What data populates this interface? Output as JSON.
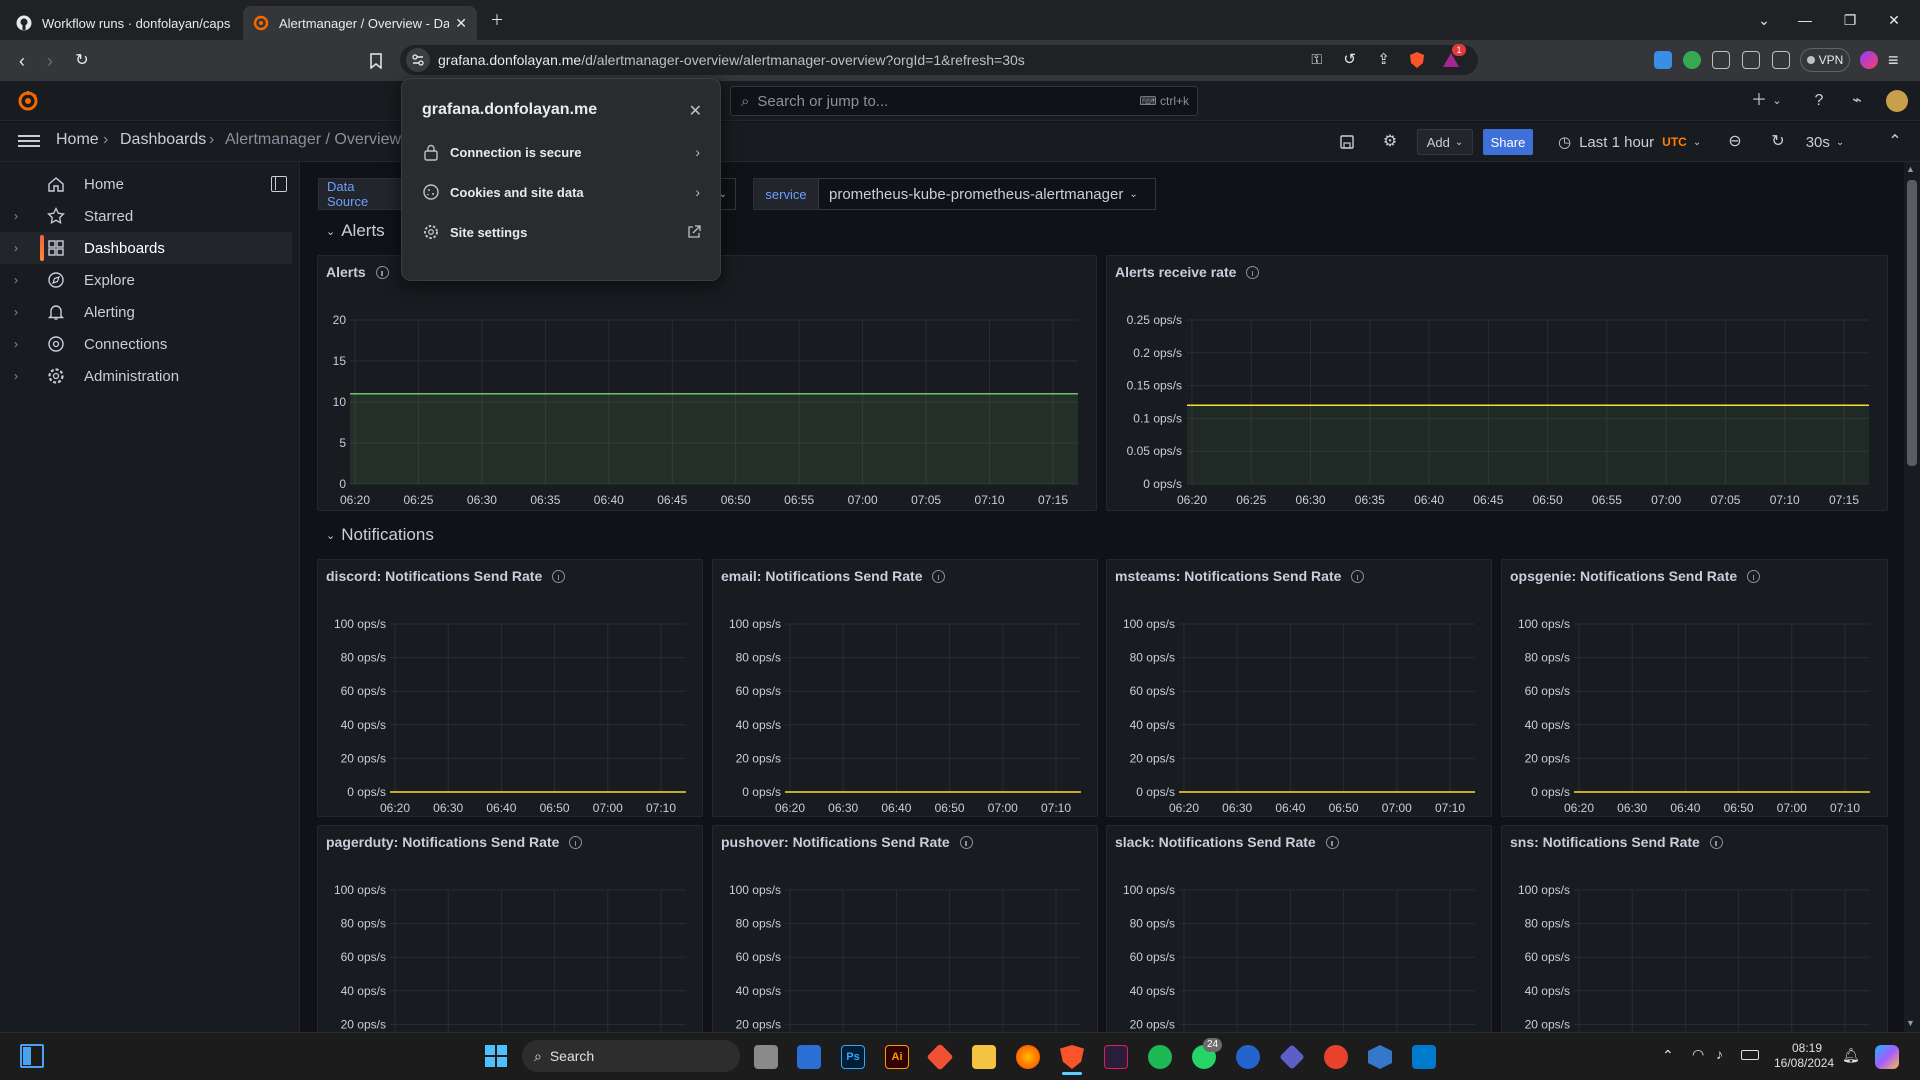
{
  "browser": {
    "tabs": [
      {
        "title": "Workflow runs · donfolayan/capstone",
        "active": false
      },
      {
        "title": "Alertmanager / Overview - Dashboards",
        "active": true
      }
    ],
    "url_host": "grafana.donfolayan.me",
    "url_path": "/d/alertmanager-overview/alertmanager-overview?orgId=1&refresh=30s",
    "vpn_label": "VPN",
    "brave_badge": "1"
  },
  "site_popup": {
    "host": "grafana.donfolayan.me",
    "items": [
      {
        "label": "Connection is secure",
        "icon": "lock-icon"
      },
      {
        "label": "Cookies and site data",
        "icon": "cookie-icon"
      },
      {
        "label": "Site settings",
        "icon": "gear-icon"
      }
    ]
  },
  "grafana": {
    "search_placeholder": "Search or jump to...",
    "search_shortcut": "ctrl+k",
    "breadcrumb": [
      "Home",
      "Dashboards",
      "Alertmanager / Overview"
    ],
    "toolbar": {
      "add": "Add",
      "share": "Share",
      "time_range": "Last 1 hour",
      "timezone": "UTC",
      "refresh": "30s"
    },
    "nav": [
      {
        "label": "Home",
        "icon": "home-icon",
        "expandable": false,
        "active": false
      },
      {
        "label": "Starred",
        "icon": "star-icon",
        "expandable": true,
        "active": false
      },
      {
        "label": "Dashboards",
        "icon": "dashboards-icon",
        "expandable": true,
        "active": true
      },
      {
        "label": "Explore",
        "icon": "compass-icon",
        "expandable": true,
        "active": false
      },
      {
        "label": "Alerting",
        "icon": "bell-icon",
        "expandable": true,
        "active": false
      },
      {
        "label": "Connections",
        "icon": "plug-icon",
        "expandable": true,
        "active": false
      },
      {
        "label": "Administration",
        "icon": "gear-icon",
        "expandable": true,
        "active": false
      }
    ],
    "variables": [
      {
        "label": "Data Source",
        "value": ""
      },
      {
        "label": "service",
        "value": "prometheus-kube-prometheus-alertmanager"
      }
    ],
    "rows": [
      {
        "title": "Alerts"
      },
      {
        "title": "Notifications"
      }
    ]
  },
  "colors": {
    "accent_orange": "#f55f3e",
    "share_blue": "#3d71d9",
    "series_green": "#73bf69",
    "series_yellow": "#fade2a"
  },
  "chart_data": [
    {
      "type": "area",
      "title": "Alerts",
      "x": [
        "06:20",
        "06:25",
        "06:30",
        "06:35",
        "06:40",
        "06:45",
        "06:50",
        "06:55",
        "07:00",
        "07:05",
        "07:10",
        "07:15"
      ],
      "y_ticks": [
        "20",
        "15",
        "10",
        "5",
        "0"
      ],
      "ylim": [
        0,
        20
      ],
      "series": [
        {
          "values": [
            11,
            11,
            11,
            11,
            11,
            11,
            11,
            11,
            11,
            11,
            11,
            11,
            11
          ]
        }
      ]
    },
    {
      "type": "line",
      "title": "Alerts receive rate",
      "x": [
        "06:20",
        "06:25",
        "06:30",
        "06:35",
        "06:40",
        "06:45",
        "06:50",
        "06:55",
        "07:00",
        "07:05",
        "07:10",
        "07:15"
      ],
      "y_ticks": [
        "0.25 ops/s",
        "0.2 ops/s",
        "0.15 ops/s",
        "0.1 ops/s",
        "0.05 ops/s",
        "0 ops/s"
      ],
      "ylim": [
        0,
        0.25
      ],
      "series": [
        {
          "values": [
            0.12,
            0.12,
            0.12,
            0.12,
            0.12,
            0.12,
            0.12,
            0.12,
            0.12,
            0.12,
            0.12,
            0.12,
            0.12
          ]
        }
      ]
    },
    {
      "type": "line",
      "title": "discord: Notifications Send Rate",
      "x": [
        "06:20",
        "06:30",
        "06:40",
        "06:50",
        "07:00",
        "07:10"
      ],
      "y_ticks": [
        "100 ops/s",
        "80 ops/s",
        "60 ops/s",
        "40 ops/s",
        "20 ops/s",
        "0 ops/s"
      ],
      "ylim": [
        0,
        100
      ],
      "series": [
        {
          "values": [
            0,
            0,
            0,
            0,
            0,
            0,
            0
          ]
        }
      ]
    },
    {
      "type": "line",
      "title": "email: Notifications Send Rate",
      "x": [
        "06:20",
        "06:30",
        "06:40",
        "06:50",
        "07:00",
        "07:10"
      ],
      "y_ticks": [
        "100 ops/s",
        "80 ops/s",
        "60 ops/s",
        "40 ops/s",
        "20 ops/s",
        "0 ops/s"
      ],
      "ylim": [
        0,
        100
      ],
      "series": [
        {
          "values": [
            0,
            0,
            0,
            0,
            0,
            0,
            0
          ]
        }
      ]
    },
    {
      "type": "line",
      "title": "msteams: Notifications Send Rate",
      "x": [
        "06:20",
        "06:30",
        "06:40",
        "06:50",
        "07:00",
        "07:10"
      ],
      "y_ticks": [
        "100 ops/s",
        "80 ops/s",
        "60 ops/s",
        "40 ops/s",
        "20 ops/s",
        "0 ops/s"
      ],
      "ylim": [
        0,
        100
      ],
      "series": [
        {
          "values": [
            0,
            0,
            0,
            0,
            0,
            0,
            0
          ]
        }
      ]
    },
    {
      "type": "line",
      "title": "opsgenie: Notifications Send Rate",
      "x": [
        "06:20",
        "06:30",
        "06:40",
        "06:50",
        "07:00",
        "07:10"
      ],
      "y_ticks": [
        "100 ops/s",
        "80 ops/s",
        "60 ops/s",
        "40 ops/s",
        "20 ops/s",
        "0 ops/s"
      ],
      "ylim": [
        0,
        100
      ],
      "series": [
        {
          "values": [
            0,
            0,
            0,
            0,
            0,
            0,
            0
          ]
        }
      ]
    },
    {
      "type": "line",
      "title": "pagerduty: Notifications Send Rate",
      "x": [],
      "y_ticks": [
        "100 ops/s",
        "80 ops/s",
        "60 ops/s",
        "40 ops/s",
        "20 ops/s"
      ],
      "ylim": [
        0,
        100
      ],
      "series": []
    },
    {
      "type": "line",
      "title": "pushover: Notifications Send Rate",
      "x": [],
      "y_ticks": [
        "100 ops/s",
        "80 ops/s",
        "60 ops/s",
        "40 ops/s",
        "20 ops/s"
      ],
      "ylim": [
        0,
        100
      ],
      "series": []
    },
    {
      "type": "line",
      "title": "slack: Notifications Send Rate",
      "x": [],
      "y_ticks": [
        "100 ops/s",
        "80 ops/s",
        "60 ops/s",
        "40 ops/s",
        "20 ops/s"
      ],
      "ylim": [
        0,
        100
      ],
      "series": []
    },
    {
      "type": "line",
      "title": "sns: Notifications Send Rate",
      "x": [],
      "y_ticks": [
        "100 ops/s",
        "80 ops/s",
        "60 ops/s",
        "40 ops/s",
        "20 ops/s"
      ],
      "ylim": [
        0,
        100
      ],
      "series": []
    }
  ],
  "taskbar": {
    "search_label": "Search",
    "whatsapp_badge": "24",
    "time": "08:19",
    "date": "16/08/2024",
    "ps_label": "Ps",
    "ai_label": "Ai"
  }
}
